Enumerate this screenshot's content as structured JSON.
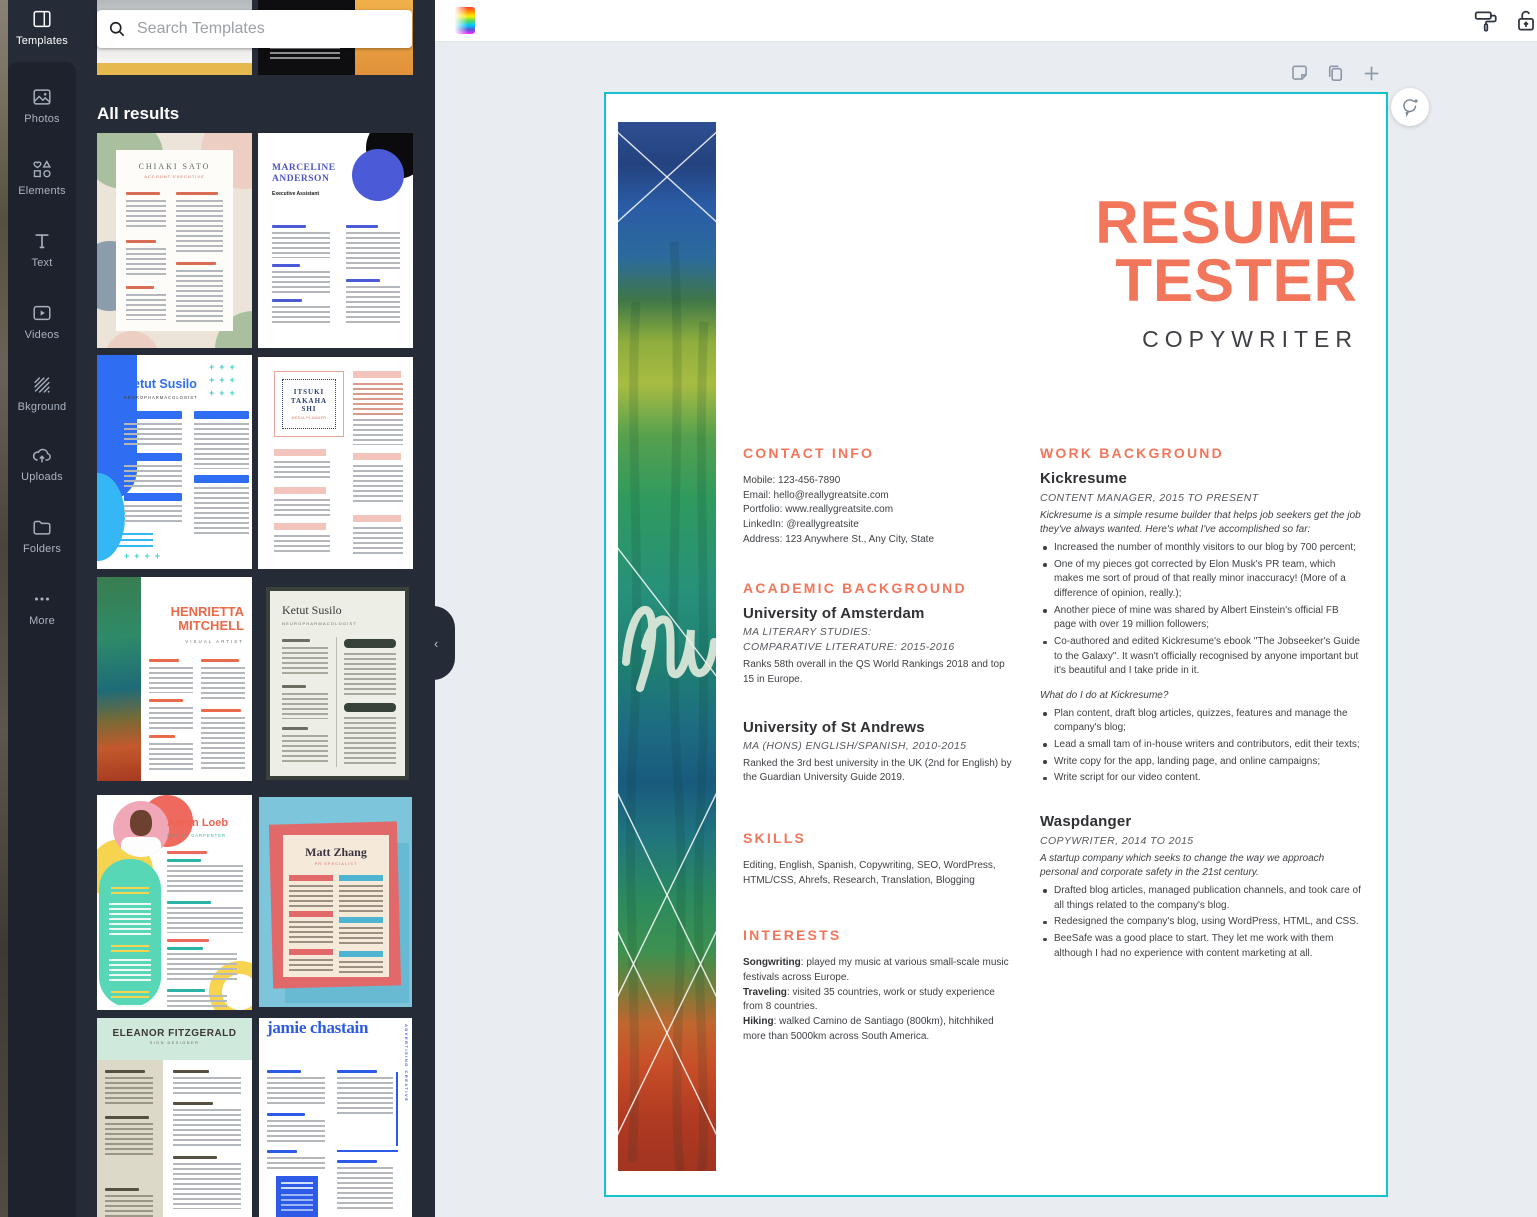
{
  "app": {
    "search": {
      "placeholder": "Search Templates"
    },
    "panel": {
      "results_label": "All results"
    },
    "sidebar": {
      "items": [
        {
          "label": "Templates"
        },
        {
          "label": "Photos"
        },
        {
          "label": "Elements"
        },
        {
          "label": "Text"
        },
        {
          "label": "Videos"
        },
        {
          "label": "Bkground"
        },
        {
          "label": "Uploads"
        },
        {
          "label": "Folders"
        },
        {
          "label": "More"
        }
      ]
    },
    "collapse_chevron": "‹"
  },
  "templates": {
    "chiaki": {
      "name": "CHIAKI SATO",
      "subtitle": "ACCOUNT EXECUTIVE"
    },
    "marceline": {
      "name": "MARCELINE ANDERSON",
      "subtitle": "Executive Assistant"
    },
    "ketut_blue": {
      "name": "Ketut Susilo",
      "subtitle": "NEUROPHARMACOLOGIST"
    },
    "itsuki": {
      "name": "ITSUKI TAKAHA SHI",
      "subtitle": "MEDIA PLANNER"
    },
    "henrietta": {
      "name": "HENRIETTA MITCHELL",
      "subtitle": "VISUAL ARTIST"
    },
    "ketut_beige": {
      "name": "Ketut Susilo",
      "subtitle": "NEUROPHARMACOLOGIST"
    },
    "aaron": {
      "name": "Aaron Loeb",
      "subtitle": "SENIOR CARPENTER"
    },
    "matt": {
      "name": "Matt Zhang",
      "subtitle": "PR SPECIALIST"
    },
    "eleanor": {
      "name": "ELEANOR FITZGERALD",
      "subtitle": "SIGN DESIGNER"
    },
    "jamie": {
      "name": "jamie chastain",
      "side_text": "ADVERTISING CREATIVE"
    }
  },
  "resume": {
    "title1": "RESUME",
    "title2": "TESTER",
    "role": "COPYWRITER",
    "contact": {
      "heading": "CONTACT INFO",
      "lines": [
        "Mobile: 123-456-7890",
        "Email: hello@reallygreatsite.com",
        "Portfolio: www.reallygreatsite.com",
        "LinkedIn: @reallygreatsite",
        "Address: 123 Anywhere St., Any City, State"
      ]
    },
    "academic": {
      "heading": "ACADEMIC BACKGROUND",
      "entries": [
        {
          "school": "University of Amsterdam",
          "degree_lines": [
            "MA LITERARY STUDIES:",
            "COMPARATIVE LITERATURE: 2015-2016"
          ],
          "desc": "Ranks 58th overall in the QS World Rankings 2018 and top 15 in Europe."
        },
        {
          "school": "University of St Andrews",
          "degree_lines": [
            "MA (HONS) ENGLISH/SPANISH, 2010-2015"
          ],
          "desc": "Ranked the 3rd best university in the UK (2nd for English) by the Guardian University Guide 2019."
        }
      ]
    },
    "skills": {
      "heading": "SKILLS",
      "text": "Editing, English, Spanish, Copywriting, SEO, WordPress, HTML/CSS, Ahrefs, Research, Translation, Blogging"
    },
    "interests": {
      "heading": "INTERESTS",
      "items": [
        {
          "label": "Songwriting",
          "text": ": played my music at various small-scale music festivals across Europe."
        },
        {
          "label": "Traveling",
          "text": ": visited 35 countries, work or study experience from 8 countries."
        },
        {
          "label": "Hiking",
          "text": ": walked Camino de Santiago (800km), hitchhiked more than 5000km across South America."
        }
      ]
    },
    "work": {
      "heading": "WORK BACKGROUND",
      "jobs": [
        {
          "company": "Kickresume",
          "role": "CONTENT MANAGER, 2015 TO PRESENT",
          "intro": "Kickresume is a simple resume builder that helps job seekers get the job they've always wanted. Here's what I've accomplished so far:",
          "bullets": [
            "Increased the number of monthly visitors to our blog by 700 percent;",
            "One of my pieces got corrected by Elon Musk's PR team, which makes me sort of proud of that really minor inaccuracy! (More of a difference of opinion, really.);",
            "Another piece of mine was shared by Albert Einstein's official FB page with over 19 million followers;",
            "Co-authored and edited Kickresume's ebook \"The Jobseeker's Guide to the Galaxy\". It wasn't officially recognised by anyone important but it's beautiful and I take pride in it."
          ],
          "question": "What do I do at Kickresume?",
          "bullets2": [
            "Plan content, draft blog articles, quizzes, features and manage the company's blog;",
            "Lead a small tam of in-house writers and contributors, edit their texts;",
            "Write copy for the app, landing page, and online campaigns;",
            "Write script for our video content."
          ]
        },
        {
          "company": "Waspdanger",
          "role": "COPYWRITER, 2014 TO 2015",
          "intro": "A startup company which seeks to change the way we approach personal and corporate safety in the 21st century.",
          "bullets": [
            "Drafted blog articles, managed publication channels, and took care of all things related to the company's blog.",
            "Redesigned the company's blog, using WordPress, HTML, and CSS.",
            "BeeSafe was a good place to start. They let me work with them although I had no experience with content marketing at all."
          ]
        }
      ]
    }
  },
  "colors": {
    "accent_orange": "#F2765B",
    "canva_teal": "#16C1CC",
    "panel_dark": "#252B37",
    "canvas_bg": "#E9EDF1"
  }
}
